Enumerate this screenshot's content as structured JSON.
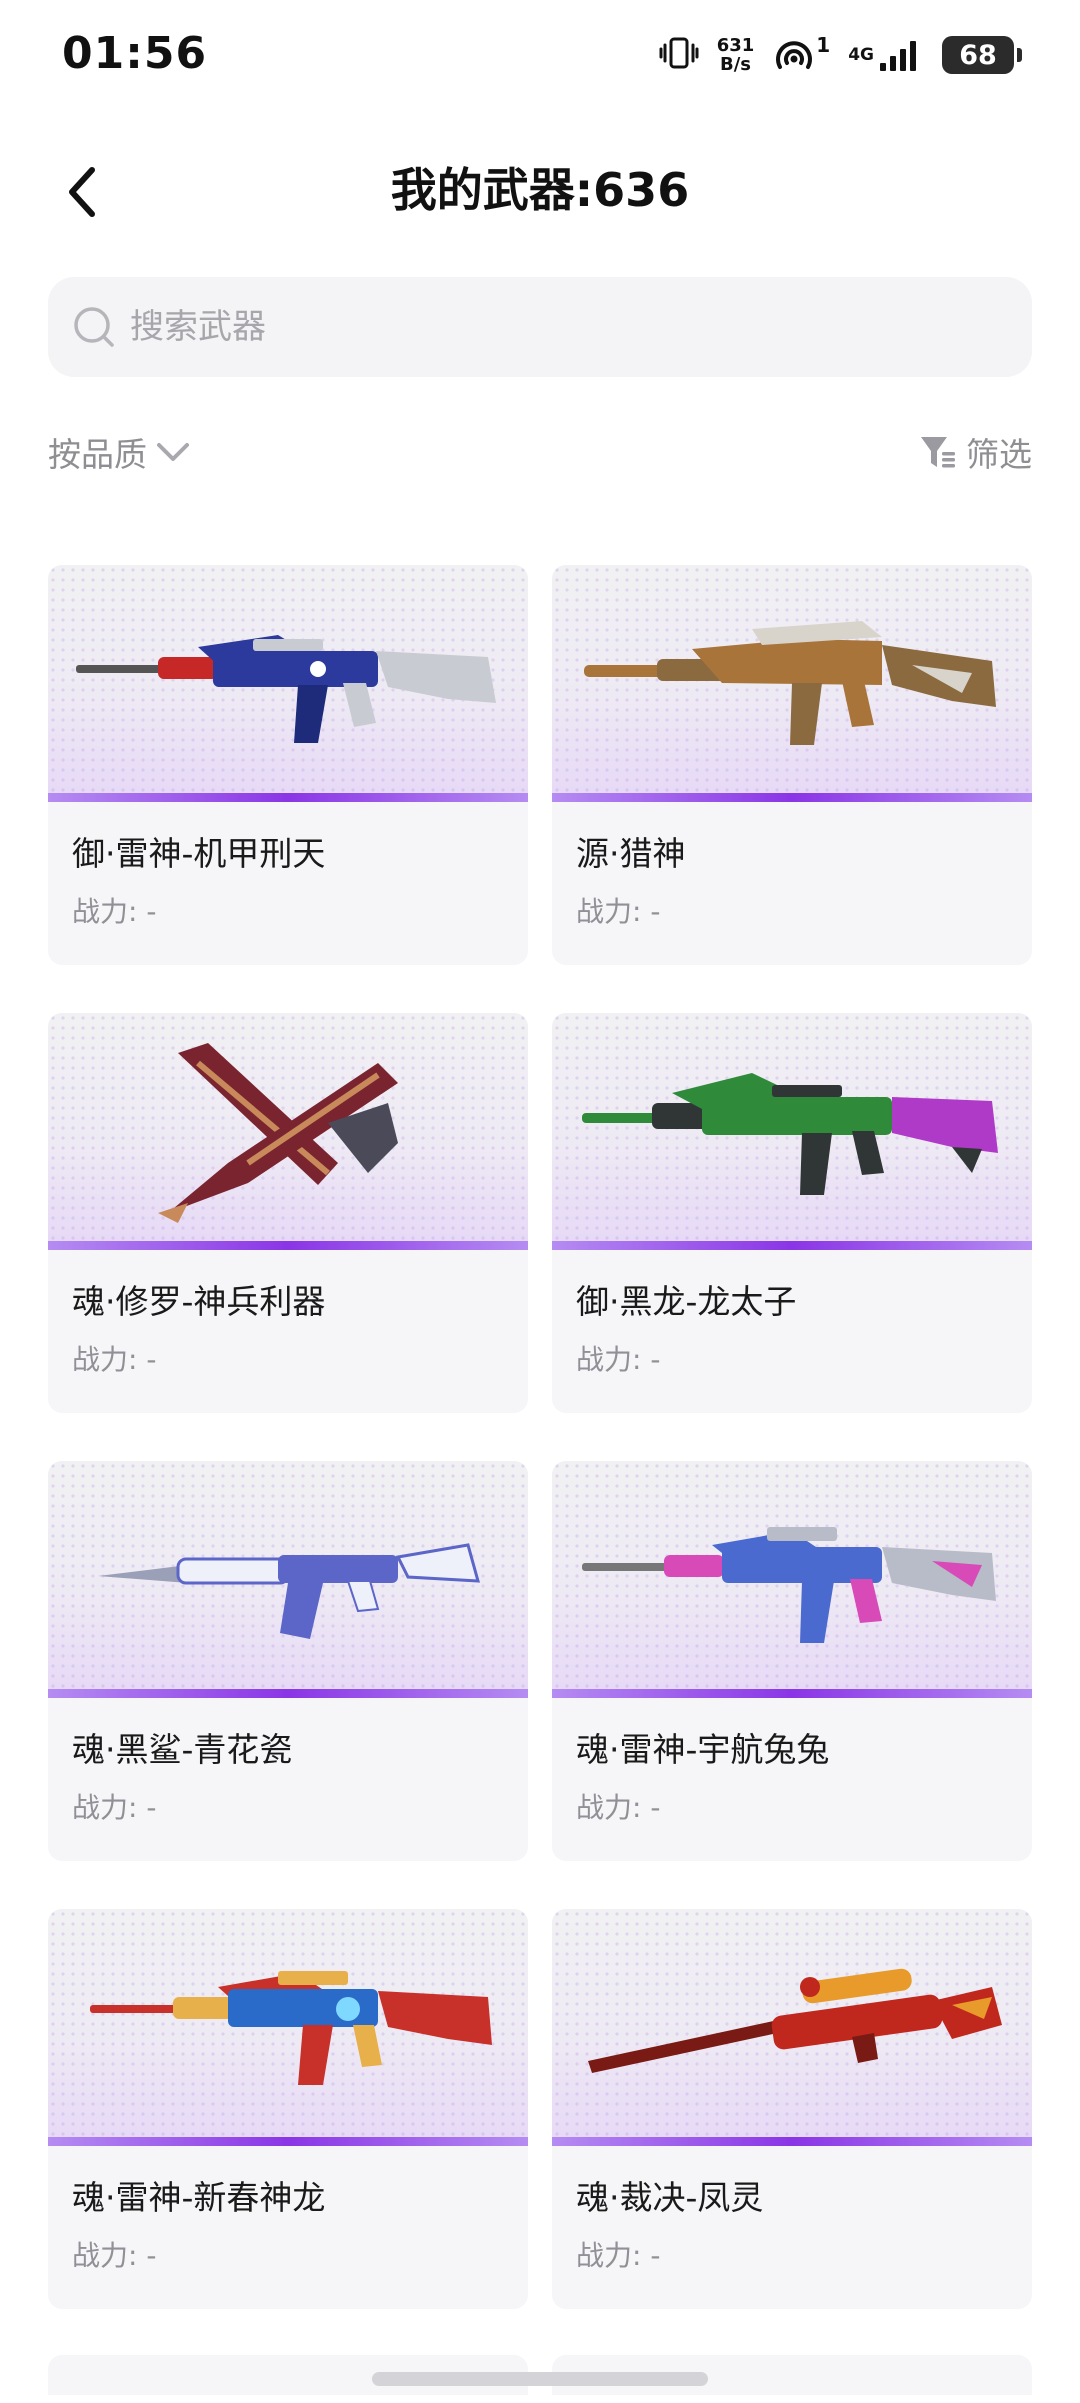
{
  "status_bar": {
    "time": "01:56",
    "net_speed_value": "631",
    "net_speed_unit": "B/s",
    "hotspot_count": "1",
    "network_type": "4G",
    "battery": "68"
  },
  "header": {
    "title": "我的武器:636"
  },
  "search": {
    "placeholder": "搜索武器"
  },
  "toolbar": {
    "sort_label": "按品质",
    "filter_label": "筛选"
  },
  "weapons": [
    {
      "name": "御·雷神-机甲刑天",
      "power": "战力: -",
      "colors": {
        "primary": "#2b3a9c",
        "accent": "#c62828",
        "metal": "#c9cbd3"
      }
    },
    {
      "name": "源·猎神",
      "power": "战力: -",
      "colors": {
        "primary": "#a8743a",
        "accent": "#d8d4cc",
        "metal": "#8a6a3e"
      }
    },
    {
      "name": "魂·修罗-神兵利器",
      "power": "战力: -",
      "colors": {
        "primary": "#7a2430",
        "accent": "#c88a5a",
        "metal": "#4a4a58"
      }
    },
    {
      "name": "御·黑龙-龙太子",
      "power": "战力: -",
      "colors": {
        "primary": "#2f8a3a",
        "accent": "#b03ac8",
        "metal": "#303636"
      }
    },
    {
      "name": "魂·黑鲨-青花瓷",
      "power": "战力: -",
      "colors": {
        "primary": "#5b66c8",
        "accent": "#eef0fa",
        "metal": "#9aa0b8"
      }
    },
    {
      "name": "魂·雷神-宇航兔兔",
      "power": "战力: -",
      "colors": {
        "primary": "#4a6ad0",
        "accent": "#d84ab8",
        "metal": "#b8bcc8"
      }
    },
    {
      "name": "魂·雷神-新春神龙",
      "power": "战力: -",
      "colors": {
        "primary": "#c8302a",
        "accent": "#2a6ac8",
        "metal": "#e8b04a"
      }
    },
    {
      "name": "魂·裁决-凤灵",
      "power": "战力: -",
      "colors": {
        "primary": "#c0281e",
        "accent": "#e89a2a",
        "metal": "#7a1a14"
      }
    }
  ]
}
